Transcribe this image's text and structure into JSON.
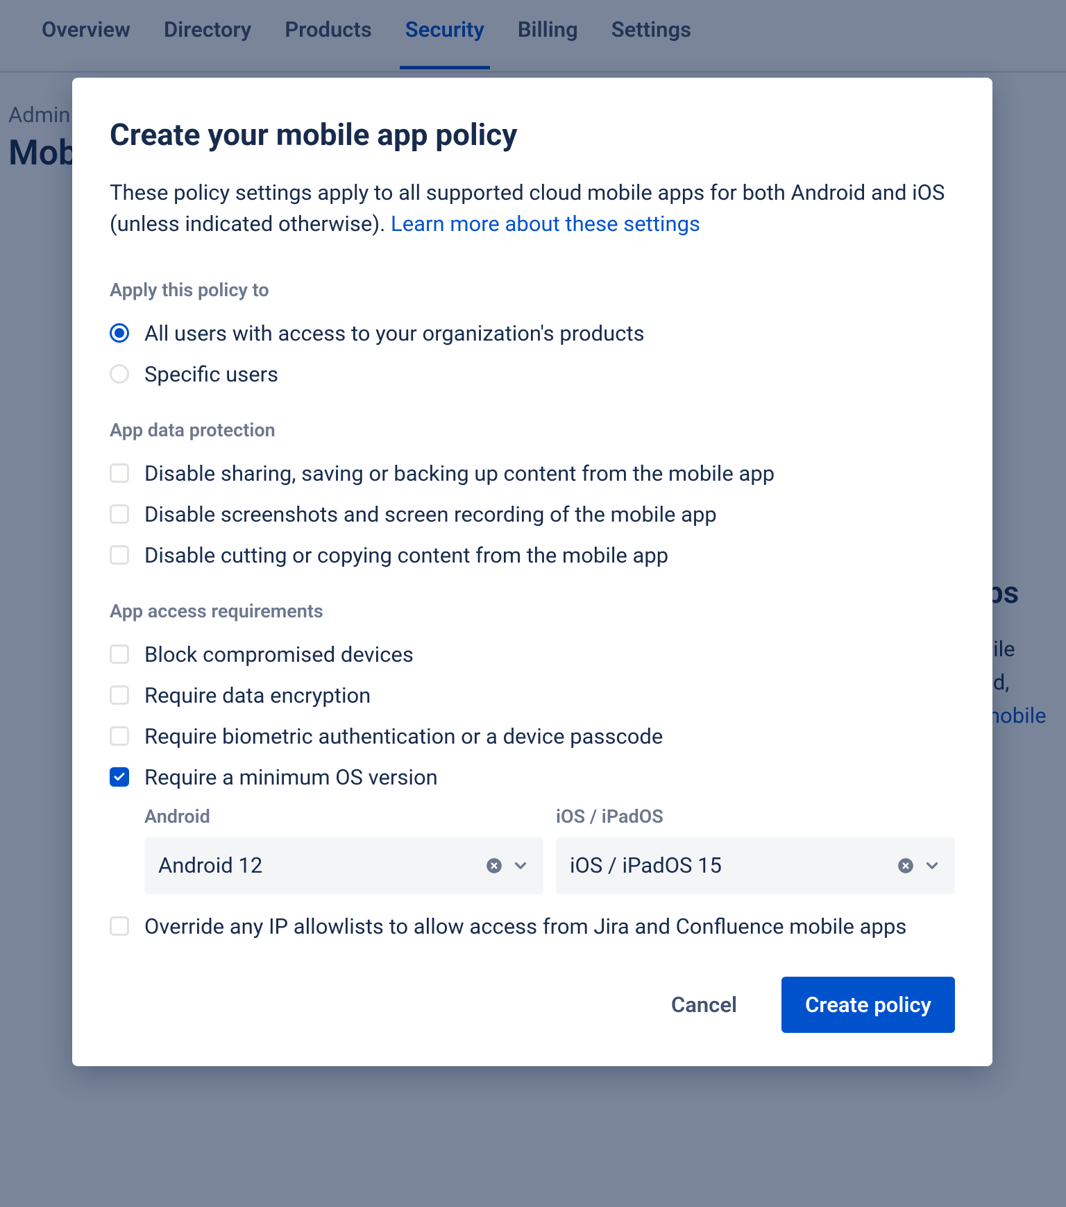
{
  "tabs": {
    "overview": "Overview",
    "directory": "Directory",
    "products": "Products",
    "security": "Security",
    "billing": "Billing",
    "settings": "Settings",
    "active": "security"
  },
  "page": {
    "breadcrumb": "Admin",
    "title": "Mob",
    "peek_heading": "ops",
    "peek_line1": "obile",
    "peek_line2": "oud,",
    "peek_link": "t mobile"
  },
  "modal": {
    "title": "Create your mobile app policy",
    "desc": "These policy settings apply to all supported cloud mobile apps for both Android and iOS (unless indicated otherwise). ",
    "learn_more": "Learn more about these settings",
    "apply_to": {
      "label": "Apply this policy to",
      "all": "All users with access to your organization's products",
      "specific": "Specific users",
      "selected": "all"
    },
    "data_protection": {
      "label": "App data protection",
      "disable_sharing": "Disable sharing, saving or backing up content from the mobile app",
      "disable_screenshots": "Disable screenshots and screen recording of the mobile app",
      "disable_copy": "Disable cutting or copying content from the mobile app"
    },
    "access_reqs": {
      "label": "App access requirements",
      "block_compromised": "Block compromised devices",
      "require_encryption": "Require data encryption",
      "require_biometric": "Require biometric authentication or a device passcode",
      "require_min_os": "Require a minimum OS version",
      "android_label": "Android",
      "android_value": "Android 12",
      "ios_label": "iOS / iPadOS",
      "ios_value": "iOS / iPadOS 15",
      "override_ip": "Override any IP allowlists to allow access from Jira and Confluence mobile apps"
    },
    "actions": {
      "cancel": "Cancel",
      "create": "Create policy"
    }
  }
}
